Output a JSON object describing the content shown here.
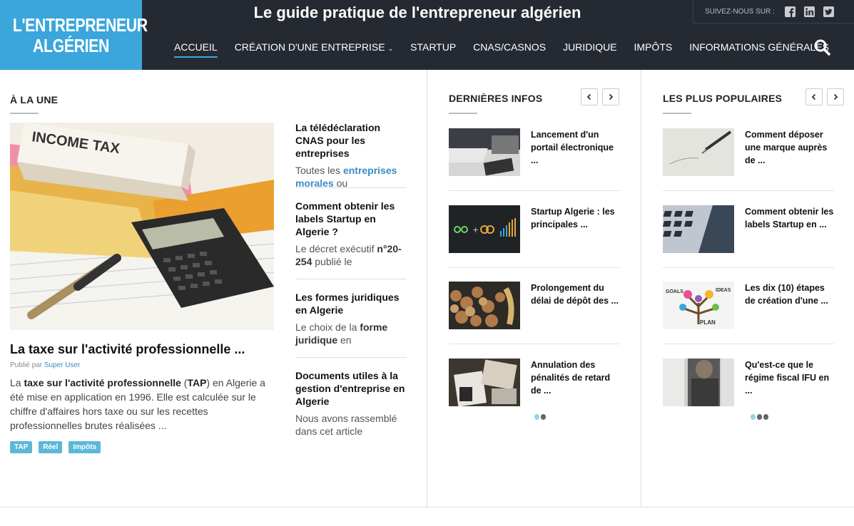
{
  "header": {
    "logo_line1": "L'ENTREPRENEUR",
    "logo_line2": "ALGÉRIEN",
    "tagline": "Le guide pratique de l'entrepreneur algérien",
    "follow_label": "SUIVEZ-NOUS SUR :",
    "social_icons": [
      "facebook-icon",
      "linkedin-icon",
      "twitter-icon"
    ],
    "nav": [
      "ACCUEIL",
      "CRÉATION D'UNE ENTREPRISE",
      "STARTUP",
      "CNAS/CASNOS",
      "JURIDIQUE",
      "IMPÔTS",
      "INFORMATIONS GÉNÉRALES"
    ],
    "active_nav": "ACCUEIL",
    "accent_color": "#3aa6dc",
    "header_bg": "#252a32"
  },
  "une": {
    "title": "À LA UNE",
    "hero": {
      "title": "La taxe sur l'activité professionnelle ...",
      "byline_prefix": "Publié par",
      "author": "Super User",
      "excerpt_pre": "La ",
      "excerpt_bold1": "taxe sur l'activité professionnelle",
      "excerpt_mid1": " (",
      "excerpt_bold2": "TAP",
      "excerpt_rest": ") en Algerie a été mise en application en 1996. Elle est calculée sur le chiffre d'affaires hors taxe ou sur les recettes professionnelles brutes réalisées ...",
      "image_label": "INCOME TAX",
      "tags": [
        "TAP",
        "Réel",
        "Impôts"
      ]
    },
    "side": [
      {
        "title": "La télédéclaration CNAS pour les entreprises",
        "excerpt_pre": "Toutes les ",
        "excerpt_link": "entreprises morales",
        "excerpt_post": " ou"
      },
      {
        "title": "Comment obtenir les labels Startup en Algerie ?",
        "excerpt_pre": "Le décret exécutif ",
        "excerpt_bold": "n°20-254",
        "excerpt_post": " publié le"
      },
      {
        "title": "Les formes juridiques en Algerie",
        "excerpt_pre": "Le choix de la ",
        "excerpt_bold": "forme juridique",
        "excerpt_post": " en"
      },
      {
        "title": "Documents utiles à la gestion d'entreprise en Algerie",
        "excerpt_pre": "Nous avons rassemblé dans cet article",
        "excerpt_bold": "",
        "excerpt_post": ""
      }
    ]
  },
  "latest": {
    "title": "DERNIÈRES INFOS",
    "items": [
      "Lancement d'un portail électronique ...",
      "Startup Algerie : les principales ...",
      "Prolongement du délai de dépôt des ...",
      "Annulation des pénalités de retard de ..."
    ],
    "pager_active": 0,
    "pager_count": 2
  },
  "popular": {
    "title": "LES PLUS POPULAIRES",
    "items": [
      "Comment déposer une marque auprès de ...",
      "Comment obtenir les labels Startup en ...",
      "Les dix (10) étapes de création d'une ...",
      "Qu'est-ce que le régime fiscal IFU en ..."
    ],
    "pager_active": 0,
    "pager_count": 3
  }
}
